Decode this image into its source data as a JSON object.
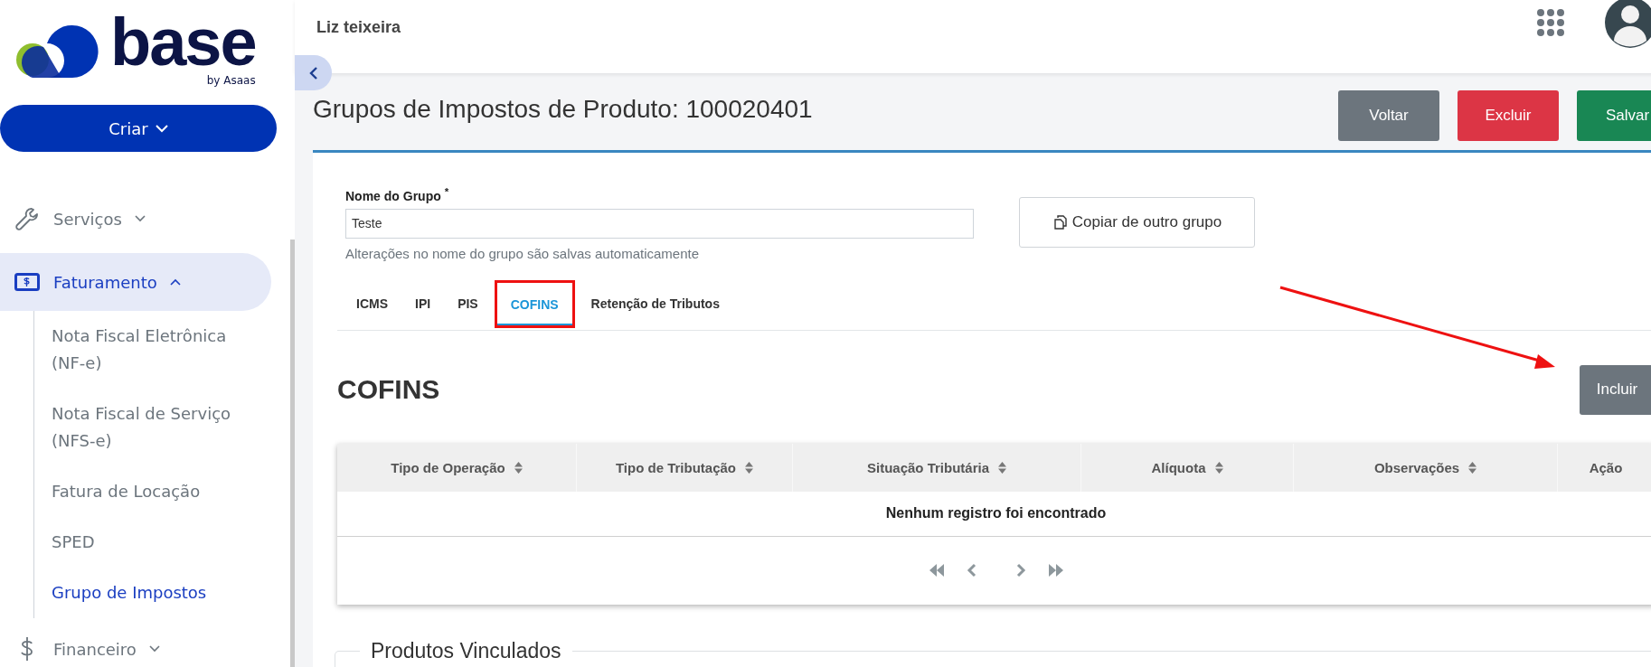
{
  "sidebar": {
    "logo": {
      "wordmark": "base",
      "tagline": "by Asaas"
    },
    "create_button": "Criar",
    "items": [
      {
        "label": "Serviços",
        "expanded": false,
        "selected": false
      },
      {
        "label": "Faturamento",
        "expanded": true,
        "selected": true,
        "children": [
          {
            "label": "Nota Fiscal Eletrônica (NF-e)",
            "selected": false
          },
          {
            "label": "Nota Fiscal de Serviço (NFS-e)",
            "selected": false
          },
          {
            "label": "Fatura de Locação",
            "selected": false
          },
          {
            "label": "SPED",
            "selected": false
          },
          {
            "label": "Grupo de Impostos",
            "selected": true
          }
        ]
      },
      {
        "label": "Financeiro",
        "expanded": false,
        "selected": false
      }
    ]
  },
  "topbar": {
    "user_name": "Liz teixeira"
  },
  "page": {
    "title": "Grupos de Impostos de Produto: 100020401",
    "actions": [
      {
        "label": "Voltar",
        "kind": "secondary"
      },
      {
        "label": "Excluir",
        "kind": "danger"
      },
      {
        "label": "Salvar",
        "kind": "success"
      }
    ]
  },
  "form": {
    "label": "Nome do Grupo $^{*}$",
    "value": "Teste",
    "hint": "Alterações no nome do grupo são salvas automaticamente",
    "copy_button": "Copiar de outro grupo"
  },
  "tabs": [
    {
      "label": "ICMS",
      "selected": false,
      "highlighted": false
    },
    {
      "label": "IPI",
      "selected": false,
      "highlighted": false
    },
    {
      "label": "PIS",
      "selected": false,
      "highlighted": false
    },
    {
      "label": "COFINS",
      "selected": true,
      "highlighted": true
    },
    {
      "label": "Retenção de Tributos",
      "selected": false,
      "highlighted": false
    }
  ],
  "section": {
    "heading": "COFINS",
    "add_button": "Incluir"
  },
  "table": {
    "columns": [
      {
        "label": "Tipo de Operação",
        "sortable": true
      },
      {
        "label": "Tipo de Tributação",
        "sortable": true
      },
      {
        "label": "Situação Tributária",
        "sortable": true
      },
      {
        "label": "Alíquota",
        "sortable": true
      },
      {
        "label": "Observações",
        "sortable": true
      },
      {
        "label": "Ação",
        "sortable": false
      }
    ],
    "empty_message": "Nenhum registro foi encontrado"
  },
  "linked_products": {
    "legend": "Produtos Vinculados"
  },
  "annotations": [
    {
      "kind": "arrow"
    }
  ]
}
